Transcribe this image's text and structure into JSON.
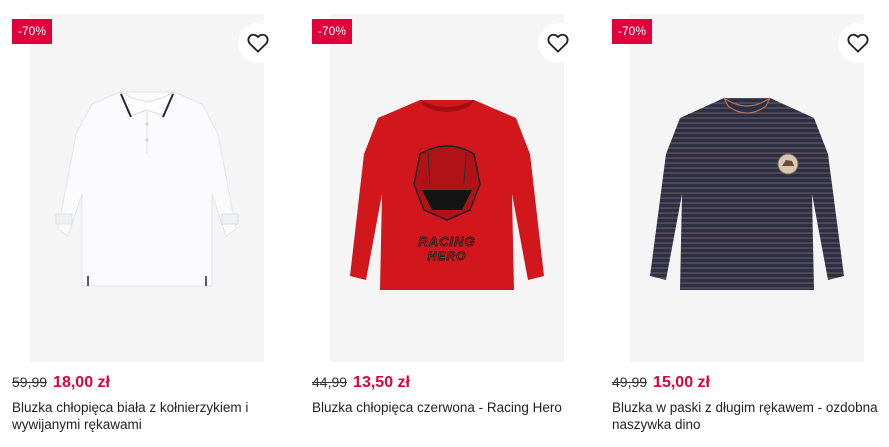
{
  "products": [
    {
      "badge": "-70%",
      "old_price": "59,99",
      "new_price": "18,00 zł",
      "name": "Bluzka chłopięca biała z kołnierzykiem i wywijanymi rękawami",
      "image": "white-polo-shirt"
    },
    {
      "badge": "-70%",
      "old_price": "44,99",
      "new_price": "13,50 zł",
      "name": "Bluzka chłopięca czerwona - Racing Hero",
      "image": "red-racing-hero-shirt"
    },
    {
      "badge": "-70%",
      "old_price": "49,99",
      "new_price": "15,00 zł",
      "name": "Bluzka w paski z długim rękawem - ozdobna naszywka dino",
      "image": "navy-striped-shirt"
    }
  ],
  "icons": {
    "favorite": "heart-outline-icon"
  },
  "colors": {
    "sale": "#e0003c",
    "image_bg": "#f5f5f5"
  }
}
